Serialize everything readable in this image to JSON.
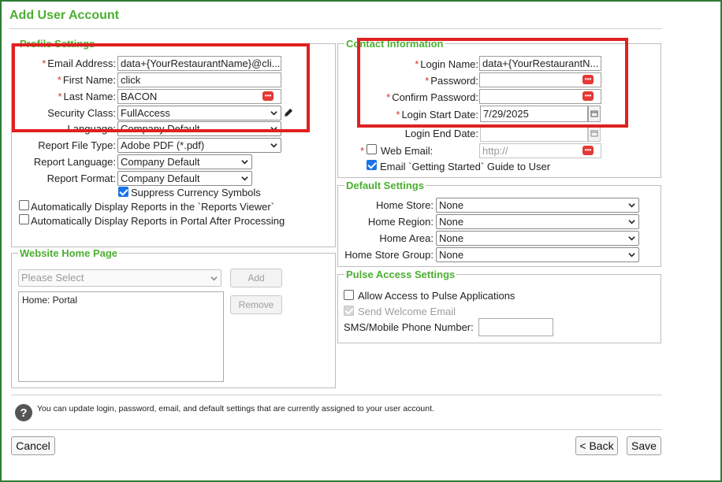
{
  "page": {
    "title": "Add User Account"
  },
  "profile": {
    "legend": "Profile Settings",
    "email_label": "Email Address:",
    "email_value": "data+{YourRestaurantName}@cli...",
    "first_name_label": "First Name:",
    "first_name_value": "click",
    "last_name_label": "Last Name:",
    "last_name_value": "BACON",
    "security_class_label": "Security Class:",
    "security_class_value": "FullAccess",
    "language_label": "Language:",
    "language_value": "Company Default",
    "report_file_type_label": "Report File Type:",
    "report_file_type_value": "Adobe PDF (*.pdf)",
    "report_language_label": "Report Language:",
    "report_language_value": "Company Default",
    "report_format_label": "Report Format:",
    "report_format_value": "Company Default",
    "suppress_currency_label": "Suppress Currency Symbols",
    "suppress_currency_checked": true,
    "auto_reports_viewer_label": "Automatically Display Reports in the `Reports Viewer`",
    "auto_reports_viewer_checked": false,
    "auto_reports_portal_label": "Automatically Display Reports in Portal After Processing",
    "auto_reports_portal_checked": false
  },
  "website_home": {
    "legend": "Website Home Page",
    "select_placeholder": "Please Select",
    "add_label": "Add",
    "remove_label": "Remove",
    "list_items": [
      "Home: Portal"
    ]
  },
  "contact": {
    "legend": "Contact Information",
    "login_name_label": "Login Name:",
    "login_name_value": "data+{YourRestaurantN...",
    "password_label": "Password:",
    "confirm_password_label": "Confirm Password:",
    "login_start_date_label": "Login Start Date:",
    "login_start_date_value": "7/29/2025",
    "login_end_date_label": "Login End Date:",
    "web_email_label": "Web Email:",
    "web_email_placeholder": "http://",
    "email_guide_label": "Email `Getting Started` Guide to User",
    "email_guide_checked": true
  },
  "defaults": {
    "legend": "Default Settings",
    "home_store_label": "Home Store:",
    "home_store_value": "None",
    "home_region_label": "Home Region:",
    "home_region_value": "None",
    "home_area_label": "Home Area:",
    "home_area_value": "None",
    "home_store_group_label": "Home Store Group:",
    "home_store_group_value": "None"
  },
  "pulse": {
    "legend": "Pulse Access Settings",
    "allow_access_label": "Allow Access to Pulse Applications",
    "send_welcome_label": "Send Welcome Email",
    "sms_label": "SMS/Mobile Phone Number:",
    "sms_value": ""
  },
  "footer": {
    "info_text": "You can update login, password, email, and default settings that are currently assigned to your user account.",
    "cancel_label": "Cancel",
    "back_label": "< Back",
    "save_label": "Save"
  },
  "colors": {
    "accent_green": "#4caf32",
    "highlight_red": "#e02020",
    "checkbox_blue": "#1a73e8"
  }
}
